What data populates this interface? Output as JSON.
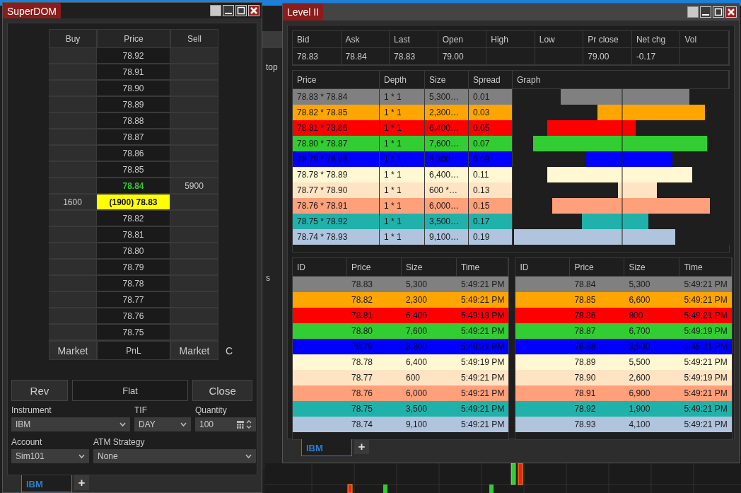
{
  "background_app": {
    "header_text": "top",
    "side_text": "s"
  },
  "superdom": {
    "title": "SuperDOM",
    "columns": [
      "Buy",
      "Price",
      "Sell"
    ],
    "rows": [
      {
        "kind": "normal",
        "buy": "",
        "price": "78.92",
        "sell": ""
      },
      {
        "kind": "normal",
        "buy": "",
        "price": "78.91",
        "sell": ""
      },
      {
        "kind": "normal",
        "buy": "",
        "price": "78.90",
        "sell": ""
      },
      {
        "kind": "normal",
        "buy": "",
        "price": "78.89",
        "sell": ""
      },
      {
        "kind": "normal",
        "buy": "",
        "price": "78.88",
        "sell": ""
      },
      {
        "kind": "normal",
        "buy": "",
        "price": "78.87",
        "sell": ""
      },
      {
        "kind": "normal",
        "buy": "",
        "price": "78.86",
        "sell": ""
      },
      {
        "kind": "normal",
        "buy": "",
        "price": "78.85",
        "sell": ""
      },
      {
        "kind": "ask",
        "buy": "",
        "price": "78.84",
        "sell": "5900"
      },
      {
        "kind": "last",
        "buy": "1600",
        "price": "(1900) 78.83",
        "sell": ""
      },
      {
        "kind": "normal",
        "buy": "",
        "price": "78.82",
        "sell": ""
      },
      {
        "kind": "normal",
        "buy": "",
        "price": "78.81",
        "sell": ""
      },
      {
        "kind": "normal",
        "buy": "",
        "price": "78.80",
        "sell": ""
      },
      {
        "kind": "normal",
        "buy": "",
        "price": "78.79",
        "sell": ""
      },
      {
        "kind": "normal",
        "buy": "",
        "price": "78.78",
        "sell": ""
      },
      {
        "kind": "normal",
        "buy": "",
        "price": "78.77",
        "sell": ""
      },
      {
        "kind": "normal",
        "buy": "",
        "price": "78.76",
        "sell": ""
      },
      {
        "kind": "normal",
        "buy": "",
        "price": "78.75",
        "sell": ""
      }
    ],
    "footer": {
      "buy": "Market",
      "price": "PnL",
      "sell": "Market",
      "side": "C"
    },
    "buttons": [
      "Rev",
      "Flat",
      "Close"
    ],
    "instrument": {
      "label": "Instrument",
      "value": "IBM"
    },
    "tif": {
      "label": "TIF",
      "value": "DAY"
    },
    "quantity": {
      "label": "Quantity",
      "value": "100"
    },
    "account": {
      "label": "Account",
      "value": "Sim101"
    },
    "atm_strategy": {
      "label": "ATM Strategy",
      "value": "None"
    },
    "tabs": [
      {
        "label": "IBM",
        "selected": true
      }
    ],
    "add_tab": "+"
  },
  "level2": {
    "title": "Level II",
    "summary": [
      {
        "label": "Bid",
        "value": "78.83"
      },
      {
        "label": "Ask",
        "value": "78.84"
      },
      {
        "label": "Last",
        "value": "78.83"
      },
      {
        "label": "Open",
        "value": "79.00"
      },
      {
        "label": "High"
      },
      {
        "label": "Low"
      },
      {
        "label": "Pr close",
        "value": "79.00"
      },
      {
        "label": "Net chg",
        "value": "-0.17"
      },
      {
        "label": "Vol"
      }
    ],
    "depth_columns": [
      "Price",
      "Depth",
      "Size",
      "Spread",
      "Graph"
    ],
    "depth_rows": [
      {
        "color": "#808080",
        "price": "78.83 * 78.84",
        "depth": "1 * 1",
        "size": "5,300…",
        "spread": "0.01"
      },
      {
        "color": "#ffa500",
        "price": "78.82 * 78.85",
        "depth": "1 * 1",
        "size": "2,300…",
        "spread": "0.03"
      },
      {
        "color": "#ff0000",
        "price": "78.81 * 78.86",
        "depth": "1 * 1",
        "size": "6,400…",
        "spread": "0.05"
      },
      {
        "color": "#32cd32",
        "price": "78.80 * 78.87",
        "depth": "1 * 1",
        "size": "7,600…",
        "spread": "0.07"
      },
      {
        "color": "#0000ff",
        "price": "78.79 * 78.88",
        "depth": "1 * 1",
        "size": "3,300…",
        "spread": "0.09"
      },
      {
        "color": "#fff8d2",
        "price": "78.78 * 78.89",
        "depth": "1 * 1",
        "size": "6,400…",
        "spread": "0.11"
      },
      {
        "color": "#ffe4c4",
        "price": "78.77 * 78.90",
        "depth": "1 * 1",
        "size": "600 *…",
        "spread": "0.13"
      },
      {
        "color": "#ffa07a",
        "price": "78.76 * 78.91",
        "depth": "1 * 1",
        "size": "6,000…",
        "spread": "0.15"
      },
      {
        "color": "#20b2aa",
        "price": "78.75 * 78.92",
        "depth": "1 * 1",
        "size": "3,500…",
        "spread": "0.17"
      },
      {
        "color": "#b0c4de",
        "price": "78.74 * 78.93",
        "depth": "1 * 1",
        "size": "9,100…",
        "spread": "0.19"
      }
    ],
    "bid_columns": [
      "ID",
      "Price",
      "Size",
      "Time"
    ],
    "ask_columns": [
      "ID",
      "Price",
      "Size",
      "Time"
    ],
    "bids": [
      {
        "color": "#808080",
        "price": "78.83",
        "size": "5,300",
        "time": "5:49:21 PM"
      },
      {
        "color": "#ffa500",
        "price": "78.82",
        "size": "2,300",
        "time": "5:49:21 PM"
      },
      {
        "color": "#ff0000",
        "price": "78.81",
        "size": "6,400",
        "time": "5:49:18 PM"
      },
      {
        "color": "#32cd32",
        "price": "78.80",
        "size": "7,600",
        "time": "5:49:21 PM"
      },
      {
        "color": "#0000ff",
        "price": "78.79",
        "size": "3,300",
        "time": "5:49:21 PM"
      },
      {
        "color": "#fff8d2",
        "price": "78.78",
        "size": "6,400",
        "time": "5:49:19 PM"
      },
      {
        "color": "#ffe4c4",
        "price": "78.77",
        "size": "600",
        "time": "5:49:21 PM"
      },
      {
        "color": "#ffa07a",
        "price": "78.76",
        "size": "6,000",
        "time": "5:49:21 PM"
      },
      {
        "color": "#20b2aa",
        "price": "78.75",
        "size": "3,500",
        "time": "5:49:21 PM"
      },
      {
        "color": "#b0c4de",
        "price": "78.74",
        "size": "9,100",
        "time": "5:49:21 PM"
      }
    ],
    "asks": [
      {
        "color": "#808080",
        "price": "78.84",
        "size": "5,300",
        "time": "5:49:21 PM"
      },
      {
        "color": "#ffa500",
        "price": "78.85",
        "size": "6,600",
        "time": "5:49:21 PM"
      },
      {
        "color": "#ff0000",
        "price": "78.86",
        "size": "800",
        "time": "5:49:21 PM"
      },
      {
        "color": "#32cd32",
        "price": "78.87",
        "size": "6,700",
        "time": "5:49:19 PM"
      },
      {
        "color": "#0000ff",
        "price": "78.88",
        "size": "3,900",
        "time": "5:49:21 PM"
      },
      {
        "color": "#fff8d2",
        "price": "78.89",
        "size": "5,500",
        "time": "5:49:21 PM"
      },
      {
        "color": "#ffe4c4",
        "price": "78.90",
        "size": "2,600",
        "time": "5:49:19 PM"
      },
      {
        "color": "#ffa07a",
        "price": "78.91",
        "size": "6,900",
        "time": "5:49:21 PM"
      },
      {
        "color": "#20b2aa",
        "price": "78.92",
        "size": "1,900",
        "time": "5:49:21 PM"
      },
      {
        "color": "#b0c4de",
        "price": "78.93",
        "size": "4,100",
        "time": "5:49:21 PM"
      }
    ],
    "tabs": [
      {
        "label": "IBM",
        "selected": true
      }
    ],
    "add_tab": "+"
  }
}
